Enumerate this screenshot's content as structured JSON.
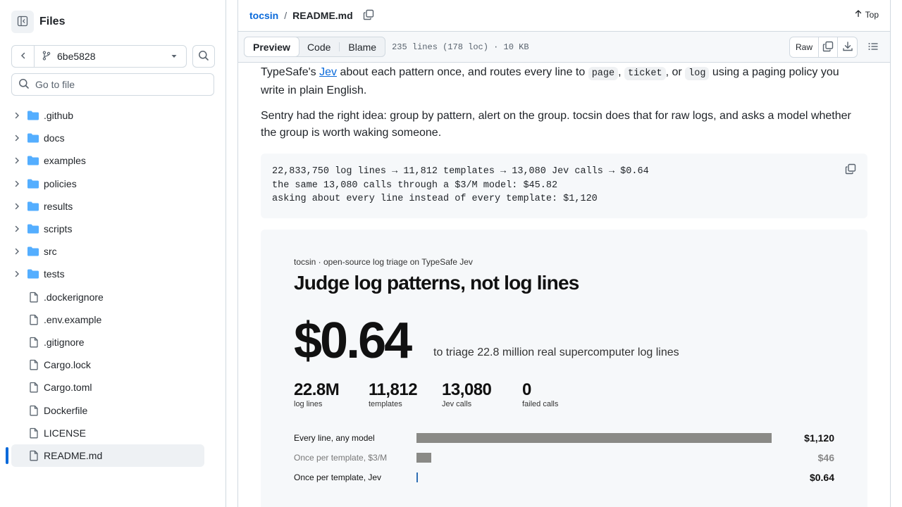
{
  "sidebar": {
    "title": "Files",
    "branch": "6be5828",
    "goto_placeholder": "Go to file",
    "items": [
      {
        "name": ".github",
        "type": "dir"
      },
      {
        "name": "docs",
        "type": "dir"
      },
      {
        "name": "examples",
        "type": "dir"
      },
      {
        "name": "policies",
        "type": "dir"
      },
      {
        "name": "results",
        "type": "dir"
      },
      {
        "name": "scripts",
        "type": "dir"
      },
      {
        "name": "src",
        "type": "dir"
      },
      {
        "name": "tests",
        "type": "dir"
      },
      {
        "name": ".dockerignore",
        "type": "file"
      },
      {
        "name": ".env.example",
        "type": "file"
      },
      {
        "name": ".gitignore",
        "type": "file"
      },
      {
        "name": "Cargo.lock",
        "type": "file"
      },
      {
        "name": "Cargo.toml",
        "type": "file"
      },
      {
        "name": "Dockerfile",
        "type": "file"
      },
      {
        "name": "LICENSE",
        "type": "file"
      },
      {
        "name": "README.md",
        "type": "file",
        "selected": true
      }
    ]
  },
  "header": {
    "repo": "tocsin",
    "sep": "/",
    "file": "README.md",
    "top_label": "Top"
  },
  "toolbar": {
    "tabs": [
      "Preview",
      "Code",
      "Blame"
    ],
    "active_tab": "Preview",
    "meta": "235 lines (178 loc) · 10 KB",
    "raw_label": "Raw"
  },
  "readme": {
    "p1_a": "TypeSafe's ",
    "p1_link": "Jev",
    "p1_b": " about each pattern once, and routes every line to ",
    "p1_code1": "page",
    "p1_c": ", ",
    "p1_code2": "ticket",
    "p1_d": ", or ",
    "p1_code3": "log",
    "p1_e": " using a paging policy you write in plain English.",
    "p2": "Sentry had the right idea: group by pattern, alert on the group. tocsin does that for raw logs, and asks a model whether the group is worth waking someone.",
    "code_lines": [
      "22,833,750 log lines → 11,812 templates → 13,080 Jev calls → $0.64",
      "the same 13,080 calls through a $3/M model: $45.82",
      "asking about every line instead of every template: $1,120"
    ]
  },
  "card": {
    "subtitle": "tocsin · open-source log triage on TypeSafe Jev",
    "headline": "Judge log patterns, not log lines",
    "price": "$0.64",
    "price_caption": "to triage 22.8 million real supercomputer log lines",
    "stats": [
      {
        "value": "22.8M",
        "label": "log lines"
      },
      {
        "value": "11,812",
        "label": "templates"
      },
      {
        "value": "13,080",
        "label": "Jev calls"
      },
      {
        "value": "0",
        "label": "failed calls"
      }
    ]
  },
  "chart_data": {
    "type": "bar",
    "orientation": "horizontal",
    "categories": [
      "Every line, any model",
      "Once per template, $3/M",
      "Once per template, Jev"
    ],
    "values": [
      1120,
      45.82,
      0.64
    ],
    "value_labels": [
      "$1,120",
      "$46",
      "$0.64"
    ],
    "colors": [
      "#8a8a86",
      "#8a8a86",
      "#2f6fb4"
    ],
    "label_colors": [
      "#111111",
      "#888888",
      "#111111"
    ]
  }
}
